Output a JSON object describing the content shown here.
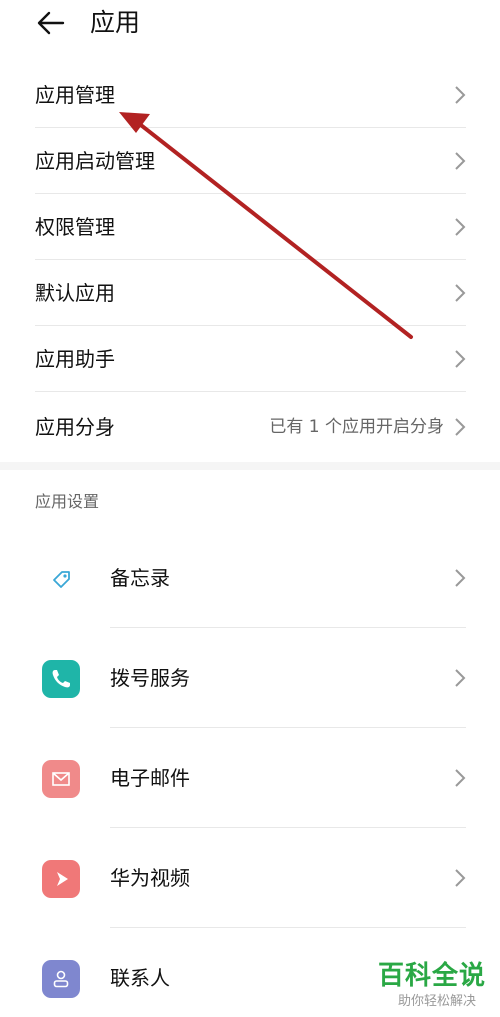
{
  "header": {
    "title": "应用"
  },
  "menu": [
    {
      "label": "应用管理",
      "value": ""
    },
    {
      "label": "应用启动管理",
      "value": ""
    },
    {
      "label": "权限管理",
      "value": ""
    },
    {
      "label": "默认应用",
      "value": ""
    },
    {
      "label": "应用助手",
      "value": ""
    },
    {
      "label": "应用分身",
      "value": "已有 1 个应用开启分身"
    }
  ],
  "section": {
    "title": "应用设置"
  },
  "apps": [
    {
      "label": "备忘录",
      "icon": "memo-tag-icon",
      "color": "#ffffff"
    },
    {
      "label": "拨号服务",
      "icon": "phone-icon",
      "color": "#1fb5a8"
    },
    {
      "label": "电子邮件",
      "icon": "mail-icon",
      "color": "#f08a8a"
    },
    {
      "label": "华为视频",
      "icon": "play-icon",
      "color": "#f07878"
    },
    {
      "label": "联系人",
      "icon": "contact-icon",
      "color": "#7f87cf"
    }
  ],
  "watermark": {
    "title": "百科全说",
    "subtitle": "助你轻松解决"
  },
  "colors": {
    "annotation_arrow": "#b22222",
    "watermark": "#2aa845"
  }
}
